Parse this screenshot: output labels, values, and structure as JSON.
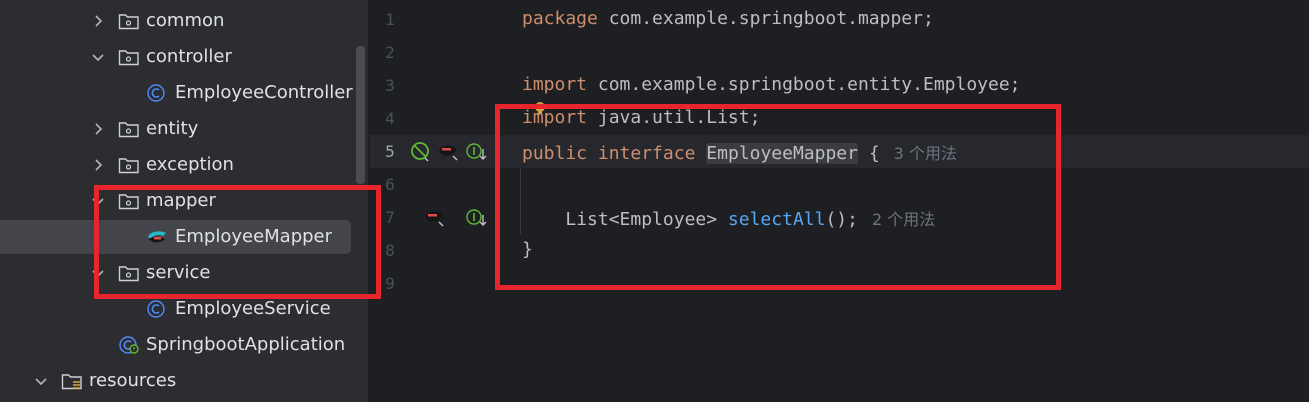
{
  "tree": {
    "items": [
      {
        "label": "common",
        "icon": "folder-icon",
        "chevron": "chevron-right-icon"
      },
      {
        "label": "controller",
        "icon": "folder-icon",
        "chevron": "chevron-down-icon"
      },
      {
        "label": "EmployeeController",
        "icon": "class-icon"
      },
      {
        "label": "entity",
        "icon": "folder-icon",
        "chevron": "chevron-right-icon"
      },
      {
        "label": "exception",
        "icon": "folder-icon",
        "chevron": "chevron-right-icon"
      },
      {
        "label": "mapper",
        "icon": "folder-icon",
        "chevron": "chevron-down-icon"
      },
      {
        "label": "EmployeeMapper",
        "icon": "mybatis-mapper-icon",
        "selected": true
      },
      {
        "label": "service",
        "icon": "folder-icon",
        "chevron": "chevron-down-icon"
      },
      {
        "label": "EmployeeService",
        "icon": "class-icon"
      },
      {
        "label": "SpringbootApplication",
        "icon": "spring-boot-class-icon"
      },
      {
        "label": "resources",
        "icon": "resources-folder-icon",
        "chevron": "chevron-down-icon"
      }
    ]
  },
  "editor": {
    "line_numbers": [
      "1",
      "2",
      "3",
      "4",
      "5",
      "6",
      "7",
      "8",
      "9"
    ],
    "active_line": "5",
    "line1": {
      "kw": "package",
      "rest": " com.example.springboot.mapper;"
    },
    "line3": {
      "kw": "import",
      "rest": " com.example.springboot.entity.Employee;"
    },
    "line4": {
      "kw": "import",
      "rest": " java.util.List;"
    },
    "line5": {
      "kw1": "public",
      "kw2": "interface",
      "name": "EmployeeMapper",
      "brace": " {",
      "hint": "3 个用法"
    },
    "line7": {
      "indent": "    ",
      "type": "List<Employee> ",
      "method": "selectAll",
      "rest": "();",
      "hint": "2 个用法"
    },
    "line8": {
      "brace": "}"
    }
  },
  "colors": {
    "keyword": "#cf8e6d",
    "method": "#56a8f5",
    "text": "#bcbec4",
    "annotation_box": "#e8242c",
    "tree_bg": "#2b2d30",
    "editor_bg": "#1e1f22"
  }
}
